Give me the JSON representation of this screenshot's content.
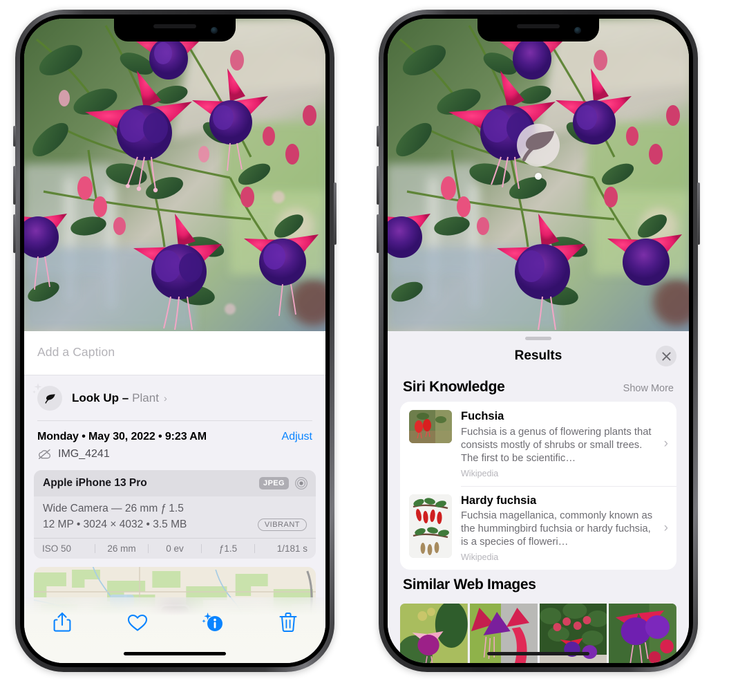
{
  "left_phone": {
    "caption": {
      "placeholder": "Add a Caption",
      "value": ""
    },
    "lookup": {
      "label": "Look Up –",
      "subject": "Plant",
      "chevron": "›",
      "icon": "leaf-icon"
    },
    "meta": {
      "date": "Monday • May 30, 2022 • 9:23 AM",
      "adjust_label": "Adjust",
      "filename": "IMG_4241",
      "cloud_icon": "cloud-slash-icon"
    },
    "exif": {
      "device": "Apple iPhone 13 Pro",
      "format_badge": "JPEG",
      "lens_icon": "aperture-icon",
      "lens": "Wide Camera — 26 mm ƒ 1.5",
      "size_line": "12 MP • 3024 × 4032 • 3.5 MB",
      "profile_badge": "VIBRANT",
      "stats": [
        "ISO 50",
        "26 mm",
        "0 ev",
        "ƒ1.5",
        "1/181 s"
      ]
    },
    "toolbar": [
      {
        "name": "share-icon",
        "label": "Share"
      },
      {
        "name": "heart-icon",
        "label": "Favorite"
      },
      {
        "name": "info-sparkle-icon",
        "label": "Info"
      },
      {
        "name": "trash-icon",
        "label": "Delete"
      }
    ]
  },
  "right_phone": {
    "marker": {
      "icon": "leaf-icon"
    },
    "sheet": {
      "title": "Results",
      "close_icon": "close-icon",
      "sections": [
        {
          "title": "Siri Knowledge",
          "action_label": "Show More",
          "items": [
            {
              "title": "Fuchsia",
              "description": "Fuchsia is a genus of flowering plants that consists mostly of shrubs or small trees. The first to be scientific…",
              "source": "Wikipedia",
              "chevron": "›"
            },
            {
              "title": "Hardy fuchsia",
              "description": "Fuchsia magellanica, commonly known as the hummingbird fuchsia or hardy fuchsia, is a species of floweri…",
              "source": "Wikipedia",
              "chevron": "›"
            }
          ]
        },
        {
          "title": "Similar Web Images",
          "items": [
            {
              "name": "web-image-1"
            },
            {
              "name": "web-image-2"
            },
            {
              "name": "web-image-3"
            },
            {
              "name": "web-image-4"
            }
          ]
        }
      ]
    }
  },
  "colors": {
    "accent_blue": "#0a84ff",
    "sheet_bg": "#f1f0f5",
    "card_bg": "#ffffff",
    "exif_bg": "#e7e6eb",
    "muted_text": "#8d8c92"
  }
}
